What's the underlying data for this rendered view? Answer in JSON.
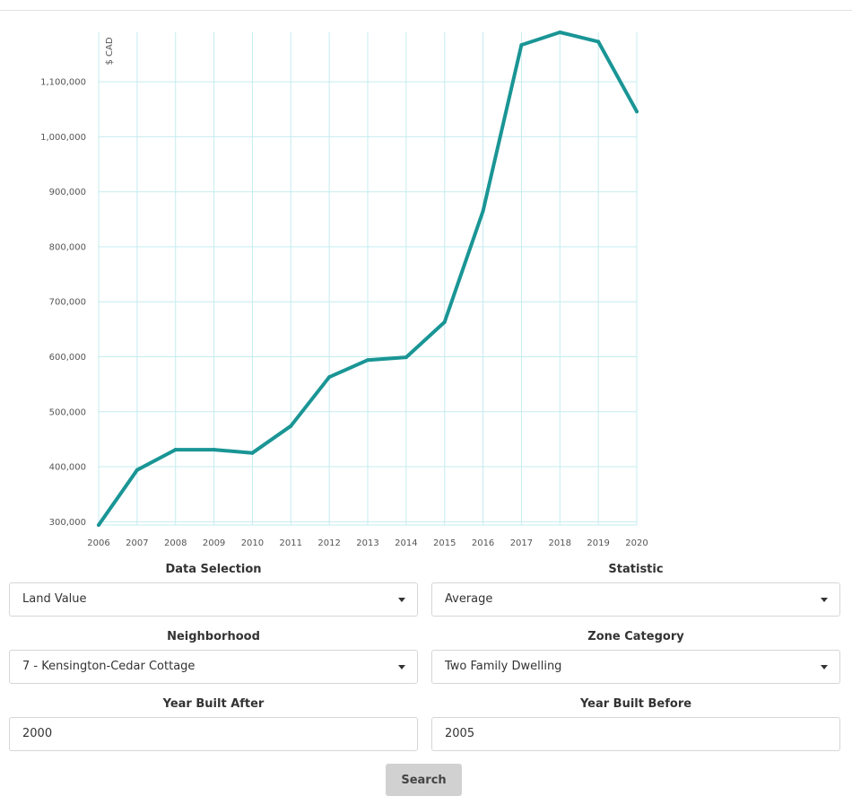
{
  "colors": {
    "line": "#1a9595",
    "grid": "#c5ecef",
    "axis_text": "#555555"
  },
  "chart_data": {
    "type": "line",
    "ylabel": "$ CAD",
    "xlabel": "",
    "x": [
      2006,
      2007,
      2008,
      2009,
      2010,
      2011,
      2012,
      2013,
      2014,
      2015,
      2016,
      2017,
      2018,
      2019,
      2020
    ],
    "series": [
      {
        "values": [
          294000,
          394000,
          431000,
          431000,
          425000,
          474000,
          563000,
          594000,
          599000,
          663000,
          865000,
          1167000,
          1190000,
          1173000,
          1046000
        ]
      }
    ],
    "yticks": [
      300000,
      400000,
      500000,
      600000,
      700000,
      800000,
      900000,
      1000000,
      1100000
    ],
    "ytick_labels": [
      "300,000",
      "400,000",
      "500,000",
      "600,000",
      "700,000",
      "800,000",
      "900,000",
      "1,000,000",
      "1,100,000"
    ],
    "xtick_labels": [
      "2006",
      "2007",
      "2008",
      "2009",
      "2010",
      "2011",
      "2012",
      "2013",
      "2014",
      "2015",
      "2016",
      "2017",
      "2018",
      "2019",
      "2020"
    ],
    "ylim": [
      294000,
      1190000
    ],
    "grid": true
  },
  "form": {
    "data_selection": {
      "label": "Data Selection",
      "value": "Land Value"
    },
    "statistic": {
      "label": "Statistic",
      "value": "Average"
    },
    "neighborhood": {
      "label": "Neighborhood",
      "value": "7 - Kensington-Cedar Cottage"
    },
    "zone_category": {
      "label": "Zone Category",
      "value": "Two Family Dwelling"
    },
    "year_built_after": {
      "label": "Year Built After",
      "value": "2000"
    },
    "year_built_before": {
      "label": "Year Built Before",
      "value": "2005"
    },
    "search_label": "Search"
  }
}
